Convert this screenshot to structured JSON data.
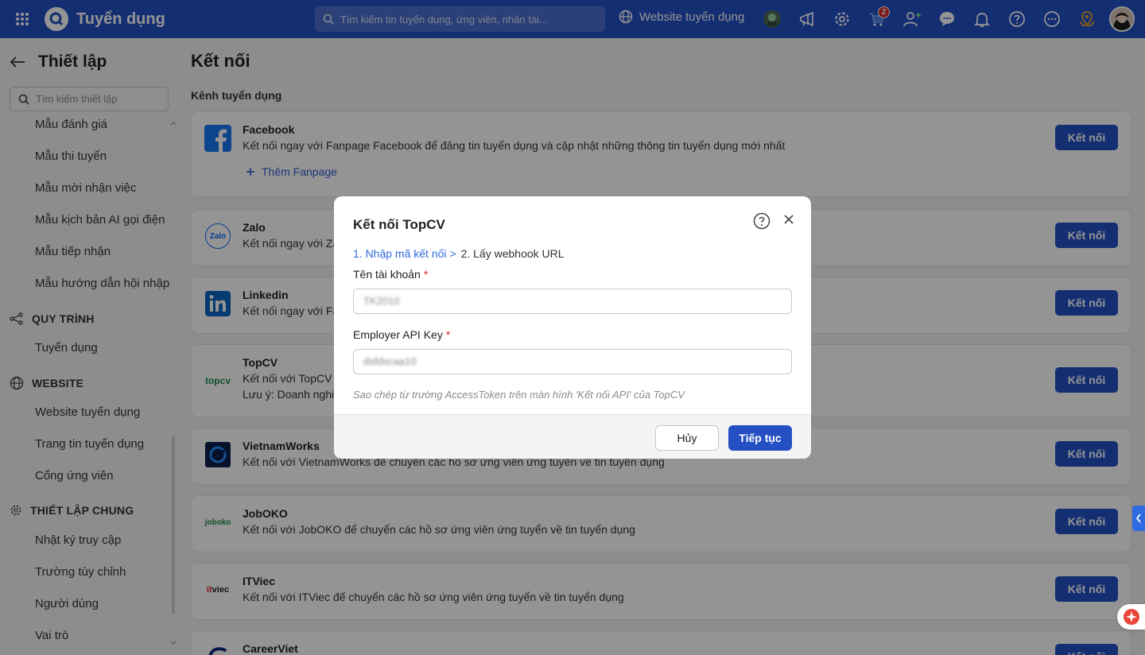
{
  "app": {
    "title": "Tuyển dụng",
    "search_placeholder": "Tìm kiếm tin tuyển dụng, ứng viên, nhân tài...",
    "site_link": "Website tuyển dụng",
    "cart_badge": "2"
  },
  "sidebar": {
    "title": "Thiết lập",
    "search_placeholder": "Tìm kiếm thiết lập",
    "items_top": [
      "Mẫu đánh giá",
      "Mẫu thi tuyển",
      "Mẫu mời nhận việc",
      "Mẫu kịch bản AI gọi điện",
      "Mẫu tiếp nhận",
      "Mẫu hướng dẫn hội nhập"
    ],
    "group_process": {
      "label": "QUY TRÌNH",
      "items": [
        "Tuyển dụng"
      ]
    },
    "group_website": {
      "label": "WEBSITE",
      "items": [
        "Website tuyển dụng",
        "Trang tin tuyển dụng",
        "Cổng ứng viên"
      ]
    },
    "group_general": {
      "label": "THIẾT LẬP CHUNG",
      "items": [
        "Nhật ký truy cập",
        "Trường tùy chỉnh",
        "Người dùng",
        "Vai trò"
      ]
    }
  },
  "main": {
    "title": "Kết nối",
    "section": "Kênh tuyển dụng",
    "connect_label": "Kết nối",
    "add_fanpage": "Thêm Fanpage",
    "channels": [
      {
        "name": "Facebook",
        "desc": "Kết nối ngay với Fanpage Facebook để đăng tin tuyển dụng và cập nhật những thông tin tuyển dụng mới nhất"
      },
      {
        "name": "Zalo",
        "desc": "Kết nối ngay với Za"
      },
      {
        "name": "Linkedin",
        "desc": "Kết nối ngay với Fa"
      },
      {
        "name": "TopCV",
        "desc": "Kết nối với TopCV c",
        "note": "Lưu ý: Doanh nghiệ"
      },
      {
        "name": "VietnamWorks",
        "desc": "Kết nối với VietnamWorks để chuyển các hồ sơ ứng viên ứng tuyển về tin tuyển dụng"
      },
      {
        "name": "JobOKO",
        "desc": "Kết nối với JobOKO để chuyển các hồ sơ ứng viên ứng tuyển về tin tuyển dụng"
      },
      {
        "name": "ITViec",
        "desc": "Kết nối với ITViec để chuyển các hồ sơ ứng viên ứng tuyển về tin tuyển dụng"
      },
      {
        "name": "CareerViet",
        "desc": ""
      }
    ],
    "logo_text": {
      "zalo": "Zalo",
      "topcv": "topcv",
      "joboko": "joboko",
      "itviec": "viec"
    }
  },
  "modal": {
    "title": "Kết nối TopCV",
    "step1": "1. Nhập mã kết nối >",
    "step2": "2. Lấy webhook URL",
    "account_label": "Tên tài khoản",
    "account_value": "TK2010",
    "api_label": "Employer API Key",
    "api_value": "dsfdscaa10",
    "required_mark": "*",
    "hint": "Sao chép từ trường AccessToken trên màn hình 'Kết nối API' của TopCV",
    "cancel": "Hủy",
    "next": "Tiếp tục"
  },
  "colors": {
    "primary": "#2450c4",
    "link": "#2e6be0",
    "required": "#e02424"
  }
}
